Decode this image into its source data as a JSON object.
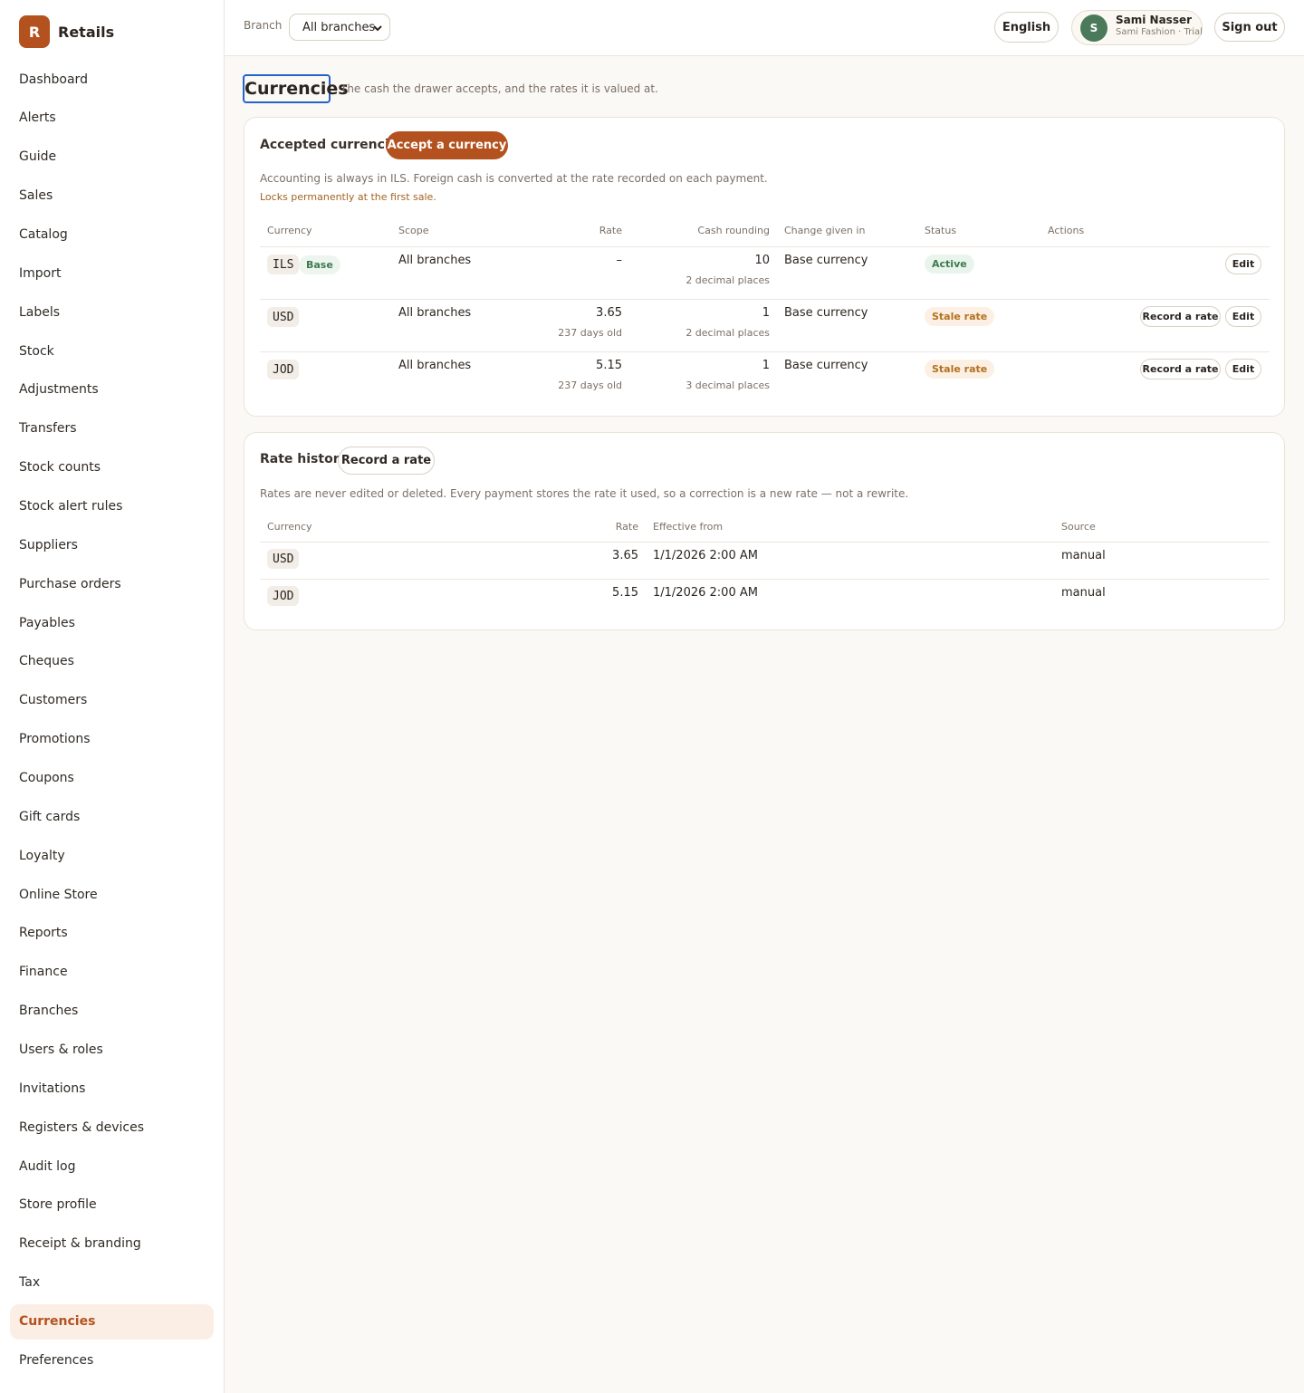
{
  "app": {
    "logo_letter": "R",
    "name": "Retails"
  },
  "sidebar": {
    "items": [
      {
        "label": "Dashboard"
      },
      {
        "label": "Alerts"
      },
      {
        "label": "Guide"
      },
      {
        "label": "Sales"
      },
      {
        "label": "Catalog"
      },
      {
        "label": "Import"
      },
      {
        "label": "Labels"
      },
      {
        "label": "Stock"
      },
      {
        "label": "Adjustments"
      },
      {
        "label": "Transfers"
      },
      {
        "label": "Stock counts"
      },
      {
        "label": "Stock alert rules"
      },
      {
        "label": "Suppliers"
      },
      {
        "label": "Purchase orders"
      },
      {
        "label": "Payables"
      },
      {
        "label": "Cheques"
      },
      {
        "label": "Customers"
      },
      {
        "label": "Promotions"
      },
      {
        "label": "Coupons"
      },
      {
        "label": "Gift cards"
      },
      {
        "label": "Loyalty"
      },
      {
        "label": "Online Store"
      },
      {
        "label": "Reports"
      },
      {
        "label": "Finance"
      },
      {
        "label": "Branches"
      },
      {
        "label": "Users & roles"
      },
      {
        "label": "Invitations"
      },
      {
        "label": "Registers & devices"
      },
      {
        "label": "Audit log"
      },
      {
        "label": "Store profile"
      },
      {
        "label": "Receipt & branding"
      },
      {
        "label": "Tax"
      },
      {
        "label": "Currencies",
        "active": true
      },
      {
        "label": "Preferences"
      }
    ]
  },
  "topbar": {
    "branch_label": "Branch",
    "branch_value": "All branches",
    "language": "English",
    "user": {
      "initial": "S",
      "name": "Sami Nasser",
      "subtitle": "Sami Fashion · Trial"
    },
    "signout": "Sign out"
  },
  "page": {
    "title": "Currencies",
    "subtitle": "The cash the drawer accepts, and the rates it is valued at."
  },
  "accepted": {
    "title": "Accepted currencies",
    "add_button": "Accept a currency",
    "note": "Accounting is always in ILS. Foreign cash is converted at the rate recorded on each payment.",
    "warning": "Locks permanently at the first sale.",
    "headers": {
      "currency": "Currency",
      "scope": "Scope",
      "rate": "Rate",
      "rounding": "Cash rounding",
      "change": "Change given in",
      "status": "Status",
      "actions": "Actions"
    },
    "rows": [
      {
        "code": "ILS",
        "base_badge": "Base",
        "scope": "All branches",
        "rate": "–",
        "rate_age": "",
        "rounding": "10",
        "decimals": "2 decimal places",
        "change": "Base currency",
        "status": "Active",
        "status_kind": "active",
        "record_label": "",
        "edit_label": "Edit"
      },
      {
        "code": "USD",
        "base_badge": "",
        "scope": "All branches",
        "rate": "3.65",
        "rate_age": "237 days old",
        "rounding": "1",
        "decimals": "2 decimal places",
        "change": "Base currency",
        "status": "Stale rate",
        "status_kind": "stale",
        "record_label": "Record a rate",
        "edit_label": "Edit"
      },
      {
        "code": "JOD",
        "base_badge": "",
        "scope": "All branches",
        "rate": "5.15",
        "rate_age": "237 days old",
        "rounding": "1",
        "decimals": "3 decimal places",
        "change": "Base currency",
        "status": "Stale rate",
        "status_kind": "stale",
        "record_label": "Record a rate",
        "edit_label": "Edit"
      }
    ]
  },
  "history": {
    "title": "Rate history",
    "record_button": "Record a rate",
    "note": "Rates are never edited or deleted. Every payment stores the rate it used, so a correction is a new rate — not a rewrite.",
    "headers": {
      "currency": "Currency",
      "rate": "Rate",
      "effective": "Effective from",
      "source": "Source"
    },
    "rows": [
      {
        "code": "USD",
        "rate": "3.65",
        "effective": "1/1/2026 2:00 AM",
        "source": "manual"
      },
      {
        "code": "JOD",
        "rate": "5.15",
        "effective": "1/1/2026 2:00 AM",
        "source": "manual"
      }
    ]
  },
  "colors": {
    "accent": "#b4521f",
    "active": "#3d7a4f",
    "stale": "#b5701f",
    "focus": "#2563c9"
  }
}
